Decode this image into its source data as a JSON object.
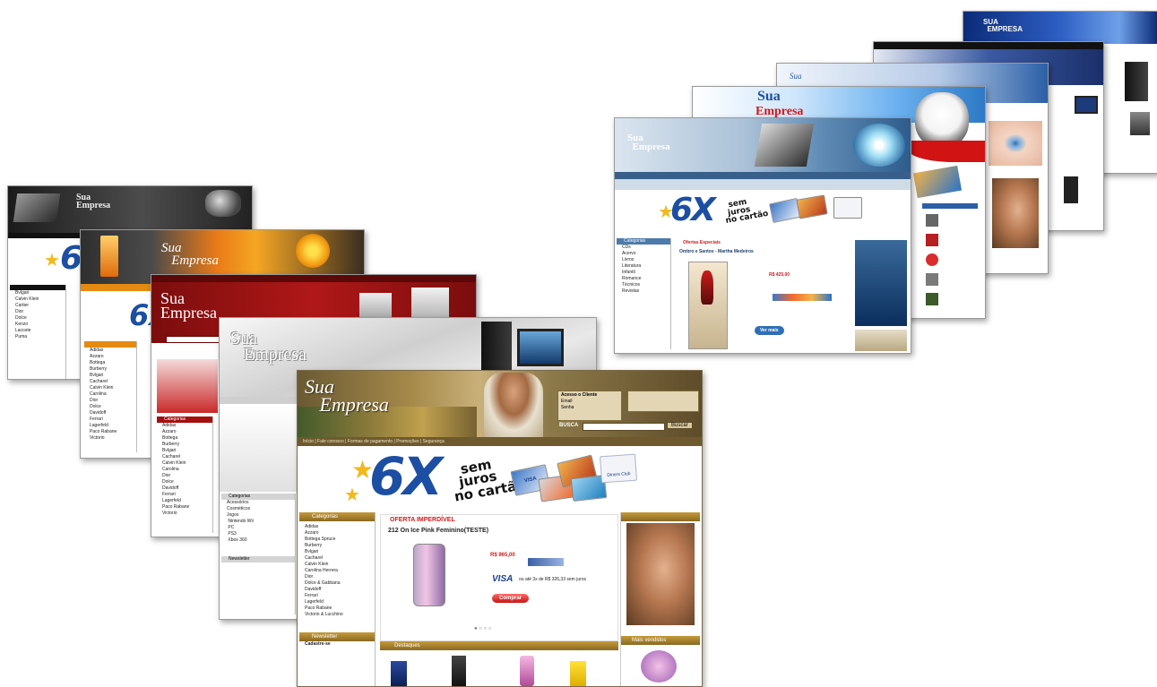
{
  "brand": {
    "line1": "Sua",
    "line2": "Empresa",
    "caps": "SUA EMPRESA"
  },
  "promo": {
    "big": "6X",
    "line1": "sem",
    "line2": "juros",
    "line3": "no cartão"
  },
  "cards": {
    "visa": "VISA",
    "diners": "Diners Club"
  },
  "front": {
    "nav": "Início | Fale conosco | Formas de pagamento | Promoções | Segurança",
    "login_title": "Acesso o Cliente",
    "login_email": "Email",
    "login_senha": "Senha",
    "busca_label": "BUSCA",
    "busca_button": "Buscar",
    "categorias_title": "Categorias",
    "categories": [
      "Adidas",
      "Azzaro",
      "Bottega Spruce",
      "Burberry",
      "Bvlgari",
      "Cacharel",
      "Calvin Klein",
      "Carolina Herrera",
      "Dior",
      "Dolce & Gabbana",
      "Davidoff",
      "Ferrari",
      "Lagerfeld",
      "Paco Rabane",
      "Victorio & Lucchino"
    ],
    "offer_title": "OFERTA IMPERDÍVEL",
    "product_name": "212 On Ice Pink Feminino(TESTE)",
    "product_price": "R$ 965,00",
    "visa_text": "ou até 3x de R$ 326,33 sem juros",
    "comprar": "Comprar",
    "destaques": "Destaques",
    "mais_vendidos": "Mais vendidos",
    "newsletter": "Newsletter",
    "cadastre": "Cadastre-se"
  },
  "modern": {
    "offer_title": "Ofertas Especiais",
    "product_name": "Ombro e Santos - Martha Medeiros",
    "price": "R$ 425,00",
    "categorias": "Categorias",
    "ver_mais": "Ver mais"
  },
  "red": {
    "categorias": "Categorias"
  },
  "silver": {
    "categorias": "Categorias",
    "newsletter": "Newsletter"
  }
}
